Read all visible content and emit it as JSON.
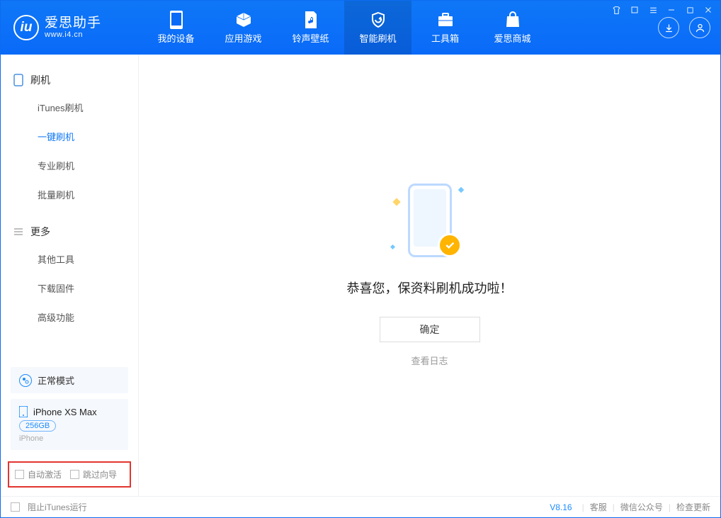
{
  "app": {
    "name_cn": "爱思助手",
    "url": "www.i4.cn"
  },
  "tabs": {
    "device": "我的设备",
    "apps": "应用游戏",
    "ringtone": "铃声壁纸",
    "flash": "智能刷机",
    "toolbox": "工具箱",
    "store": "爱思商城"
  },
  "sidebar": {
    "section_flash": "刷机",
    "items_flash": [
      "iTunes刷机",
      "一键刷机",
      "专业刷机",
      "批量刷机"
    ],
    "section_more": "更多",
    "items_more": [
      "其他工具",
      "下载固件",
      "高级功能"
    ]
  },
  "mode": {
    "label": "正常模式"
  },
  "device": {
    "name": "iPhone XS Max",
    "capacity": "256GB",
    "type": "iPhone"
  },
  "options": {
    "auto_activate": "自动激活",
    "skip_guide": "跳过向导"
  },
  "main": {
    "success": "恭喜您，保资料刷机成功啦！",
    "ok": "确定",
    "view_log": "查看日志"
  },
  "footer": {
    "block_itunes": "阻止iTunes运行",
    "version": "V8.16",
    "support": "客服",
    "wechat": "微信公众号",
    "update": "检查更新"
  }
}
